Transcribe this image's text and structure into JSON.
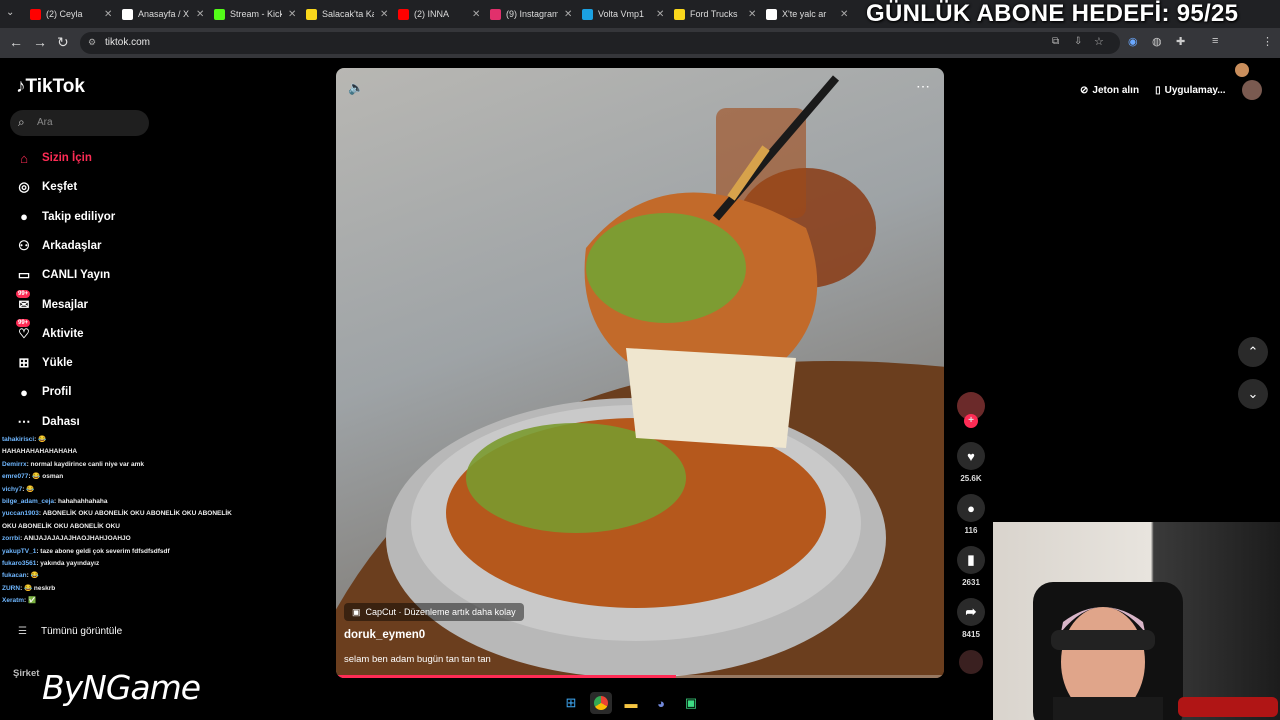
{
  "overlay": {
    "subscriber_goal": "GÜNLÜK ABONE HEDEFİ: 95/25"
  },
  "browser": {
    "tabs": [
      {
        "title": "(2) Ceyla",
        "favicon": "youtube-icon",
        "color": "#ff0000"
      },
      {
        "title": "Anasayfa / X",
        "favicon": "x-icon",
        "color": "#ffffff"
      },
      {
        "title": "Stream - Kick",
        "favicon": "kick-icon",
        "color": "#53fc18"
      },
      {
        "title": "Salacak'ta Ka",
        "favicon": "s-icon",
        "color": "#f9d71c"
      },
      {
        "title": "(2) INNA",
        "favicon": "youtube-icon",
        "color": "#ff0000"
      },
      {
        "title": "(9) Instagram",
        "favicon": "instagram-icon",
        "color": "#e1306c"
      },
      {
        "title": "Volta Vmp1",
        "favicon": "volta-icon",
        "color": "#1ba1e2"
      },
      {
        "title": "Ford Trucks",
        "favicon": "s-icon",
        "color": "#f9d71c"
      },
      {
        "title": "X'te yalc ar",
        "favicon": "x-icon",
        "color": "#ffffff"
      }
    ],
    "url": "tiktok.com"
  },
  "tiktok": {
    "logo": "TikTok",
    "search_placeholder": "Ara",
    "nav": [
      {
        "label": "Sizin İçin",
        "icon": "home-icon",
        "active": true
      },
      {
        "label": "Keşfet",
        "icon": "compass-icon"
      },
      {
        "label": "Takip ediliyor",
        "icon": "avatar-icon"
      },
      {
        "label": "Arkadaşlar",
        "icon": "friends-icon"
      },
      {
        "label": "CANLI Yayın",
        "icon": "live-icon"
      },
      {
        "label": "Mesajlar",
        "icon": "message-icon",
        "badge": "99+"
      },
      {
        "label": "Aktivite",
        "icon": "activity-icon",
        "badge": "99+"
      },
      {
        "label": "Yükle",
        "icon": "upload-icon"
      },
      {
        "label": "Profil",
        "icon": "profile-avatar-icon"
      },
      {
        "label": "Dahası",
        "icon": "more-icon"
      }
    ],
    "see_all": "Tümünü görüntüle",
    "company": "Şirket",
    "jeton": "Jeton alın",
    "app": "Uygulamay...",
    "video": {
      "capcut": "CapCut · Düzenleme artık daha kolay",
      "author": "doruk_eymen0",
      "caption": "selam ben adam bugün tan tan tan",
      "progress": 0.56
    },
    "actions": {
      "likes": "25.6K",
      "comments": "116",
      "saves": "2631",
      "shares": "8415"
    }
  },
  "chat": [
    {
      "name": "tahakirisci",
      "msg": ": 😂"
    },
    {
      "name": "",
      "msg": "HAHAHAHAHAHAHAHA"
    },
    {
      "name": "Demirrx",
      "msg": ": normal kaydirince canli niye var amk"
    },
    {
      "name": "emre077",
      "msg": ": 😂  osman"
    },
    {
      "name": "vichy7",
      "msg": ": 😂"
    },
    {
      "name": "bilge_adam_ceja",
      "msg": ": hahahahhahaha"
    },
    {
      "name": "yuccan1903",
      "msg": ": ABONELİK OKU ABONELİK OKU ABONELİK OKU ABONELİK"
    },
    {
      "name": "",
      "msg": "OKU ABONELİK OKU ABONELİK OKU"
    },
    {
      "name": "zorrbi",
      "msg": ": ANIJAJAJAJAJHAOJHAHJOAHJO"
    },
    {
      "name": "yakupTV_1",
      "msg": ": taze abone geldi çok severim fdfsdfsdfsdf"
    },
    {
      "name": "fukaro3561",
      "msg": ": yakında yayındayız"
    },
    {
      "name": "fukacan",
      "msg": ": 😂"
    },
    {
      "name": "ZURN",
      "msg": ": 😂  neskrb"
    },
    {
      "name": "Xeratm",
      "msg": ": ✅"
    }
  ],
  "watermark": "ByNGame"
}
